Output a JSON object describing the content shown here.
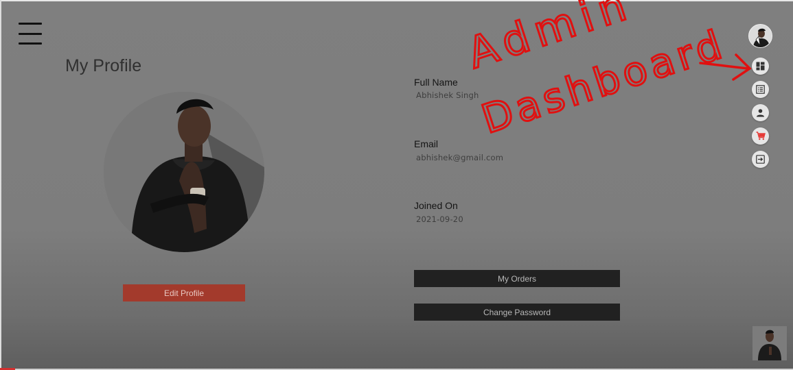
{
  "page": {
    "title": "My Profile"
  },
  "profile": {
    "edit_label": "Edit Profile",
    "fields": {
      "name_label": "Full Name",
      "name_value": "Abhishek Singh",
      "email_label": "Email",
      "email_value": "abhishek@gmail.com",
      "joined_label": "Joined On",
      "joined_value": "2021-09-20"
    },
    "buttons": {
      "orders_label": "My Orders",
      "password_label": "Change Password"
    }
  },
  "speed_dial": {
    "items": [
      {
        "icon": "dashboard-icon"
      },
      {
        "icon": "orders-list-icon"
      },
      {
        "icon": "person-icon"
      },
      {
        "icon": "cart-icon"
      },
      {
        "icon": "logout-icon"
      }
    ]
  },
  "annotation": {
    "line1": "Admin",
    "line2": "Dashboard"
  },
  "colors": {
    "accent": "#a33a2c",
    "dark_button": "#212121",
    "annotation_red": "#e01010",
    "cart_red": "#e53935"
  }
}
